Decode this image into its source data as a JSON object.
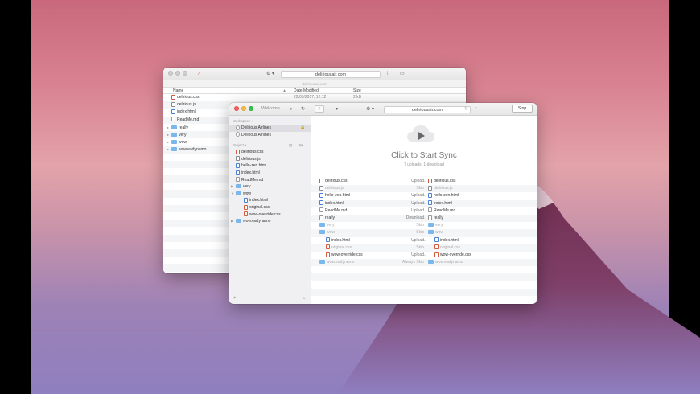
{
  "colors": {
    "close": "#fc605c",
    "minimize": "#fdbc40",
    "zoom": "#34c84a",
    "folder": "#7ab7ec",
    "accent_css": "#d65b3c",
    "accent_html": "#4a7fd6"
  },
  "back_window": {
    "url": "deliriousair.com",
    "subtitle": "deliriousair.com",
    "columns": {
      "name": "Name",
      "date": "Date Modified",
      "size": "Size"
    },
    "first_row_date": "22/09/2017, 12:12",
    "first_row_size": "2 kB",
    "rows": [
      {
        "name": "delirious.css",
        "type": "css"
      },
      {
        "name": "delirious.js",
        "type": "js"
      },
      {
        "name": "index.html",
        "type": "html"
      },
      {
        "name": "ReadMe.md",
        "type": "doc"
      },
      {
        "name": "really",
        "type": "folder"
      },
      {
        "name": "very",
        "type": "folder"
      },
      {
        "name": "wow",
        "type": "folder"
      },
      {
        "name": "wow.eadynamo",
        "type": "folder"
      }
    ]
  },
  "front_window": {
    "sidebar_title": "Welcome",
    "url": "deliriousair.com",
    "stop_label": "Stop",
    "workspace_header": "Workspace",
    "workspace_items": [
      "Delirious Airlines",
      "Delirious Airlines"
    ],
    "project_header": "Project",
    "project_items": [
      {
        "name": "delirious.css",
        "type": "css",
        "indent": false
      },
      {
        "name": "delirious.js",
        "type": "js",
        "indent": false
      },
      {
        "name": "hello-zen.html",
        "type": "html",
        "indent": false
      },
      {
        "name": "index.html",
        "type": "html",
        "indent": false
      },
      {
        "name": "ReadMe.md",
        "type": "doc",
        "indent": false
      },
      {
        "name": "very",
        "type": "folder",
        "indent": false
      },
      {
        "name": "wow",
        "type": "folder",
        "indent": false
      },
      {
        "name": "index.html",
        "type": "html",
        "indent": true
      },
      {
        "name": "original.css",
        "type": "css",
        "indent": true
      },
      {
        "name": "wow-override.css",
        "type": "css",
        "indent": true
      },
      {
        "name": "wow.eadynamo",
        "type": "folder",
        "indent": false
      }
    ],
    "sync_title": "Click to Start Sync",
    "sync_subtitle": "7 uploads, 1 download",
    "compare_rows": [
      {
        "left": "delirious.css",
        "type": "css",
        "action": "Upload",
        "arrow": "→",
        "right": "delirious.css",
        "dim": false
      },
      {
        "left": "delirious.js",
        "type": "js",
        "action": "Skip",
        "arrow": "",
        "right": "delirious.js",
        "dim": true
      },
      {
        "left": "hello-zen.html",
        "type": "html",
        "action": "Upload",
        "arrow": "→",
        "right": "hello-zen.html",
        "dim": false
      },
      {
        "left": "index.html",
        "type": "html",
        "action": "Upload",
        "arrow": "→",
        "right": "index.html",
        "dim": false
      },
      {
        "left": "ReadMe.md",
        "type": "doc",
        "action": "Upload",
        "arrow": "→",
        "right": "ReadMe.md",
        "dim": false
      },
      {
        "left": "really",
        "type": "doc",
        "action": "Download",
        "arrow": "←",
        "right": "really",
        "dim": false
      },
      {
        "left": "very",
        "type": "folder",
        "action": "Skip",
        "arrow": "",
        "right": "very",
        "dim": true
      },
      {
        "left": "wow",
        "type": "folder",
        "action": "Skip",
        "arrow": "",
        "right": "wow",
        "dim": true
      },
      {
        "left": "index.html",
        "type": "html",
        "action": "Upload",
        "arrow": "→",
        "right": "index.html",
        "dim": false
      },
      {
        "left": "original.css",
        "type": "css",
        "action": "Skip",
        "arrow": "",
        "right": "original.css",
        "dim": true
      },
      {
        "left": "wow-override.css",
        "type": "css",
        "action": "Upload",
        "arrow": "→",
        "right": "wow-override.css",
        "dim": false
      },
      {
        "left": "wow.eadynamo",
        "type": "folder",
        "action": "Always Skip",
        "arrow": "",
        "right": "wow.eadynamo",
        "dim": true
      }
    ]
  }
}
